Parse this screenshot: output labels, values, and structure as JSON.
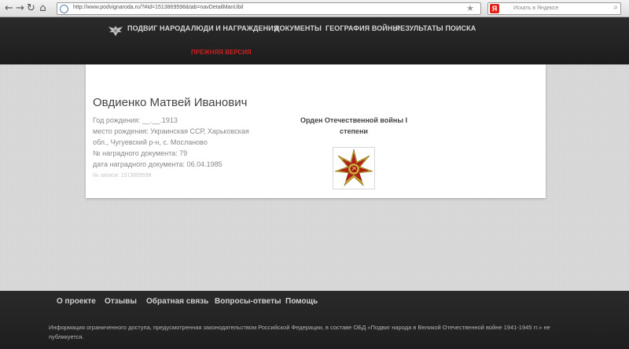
{
  "browser": {
    "url": "http://www.podvignaroda.ru/?#id=1513869598&tab=navDetailManUbil",
    "search_placeholder": "Искать в Яндексе",
    "yandex_letter": "Я"
  },
  "header": {
    "nav": [
      "ПОДВИГ НАРОДА",
      "ЛЮДИ И НАГРАЖДЕНИЯ",
      "ДОКУМЕНТЫ",
      "ГЕОГРАФИЯ ВОЙНЫ",
      "РЕЗУЛЬТАТЫ ПОИСКА"
    ],
    "old_version": "ПРЕЖНЯЯ ВЕРСИЯ"
  },
  "person": {
    "name": "Овдиенко Матвей Иванович",
    "lines": [
      "Год рождения: __.__.1913",
      "место рождения: Украинская ССР, Харьковская",
      "обл., Чугуевский р-н, с. Мосланово",
      "№ наградного документа: 79",
      "дата наградного документа: 06.04.1985"
    ],
    "record_id": "№ записи: 1513869598"
  },
  "award": {
    "line1": "Орден Отечественной войны I",
    "line2": "степени"
  },
  "footer": {
    "links": [
      "О проекте",
      "Отзывы",
      "Обратная связь",
      "Вопросы-ответы",
      "Помощь"
    ],
    "note": "Информация ограниченного доступа, предусмотренная законодательством Российской Федерации, в составе ОБД «Подвиг народа в Великой Отечественной войне 1941-1945 гг.» не публикуется."
  }
}
